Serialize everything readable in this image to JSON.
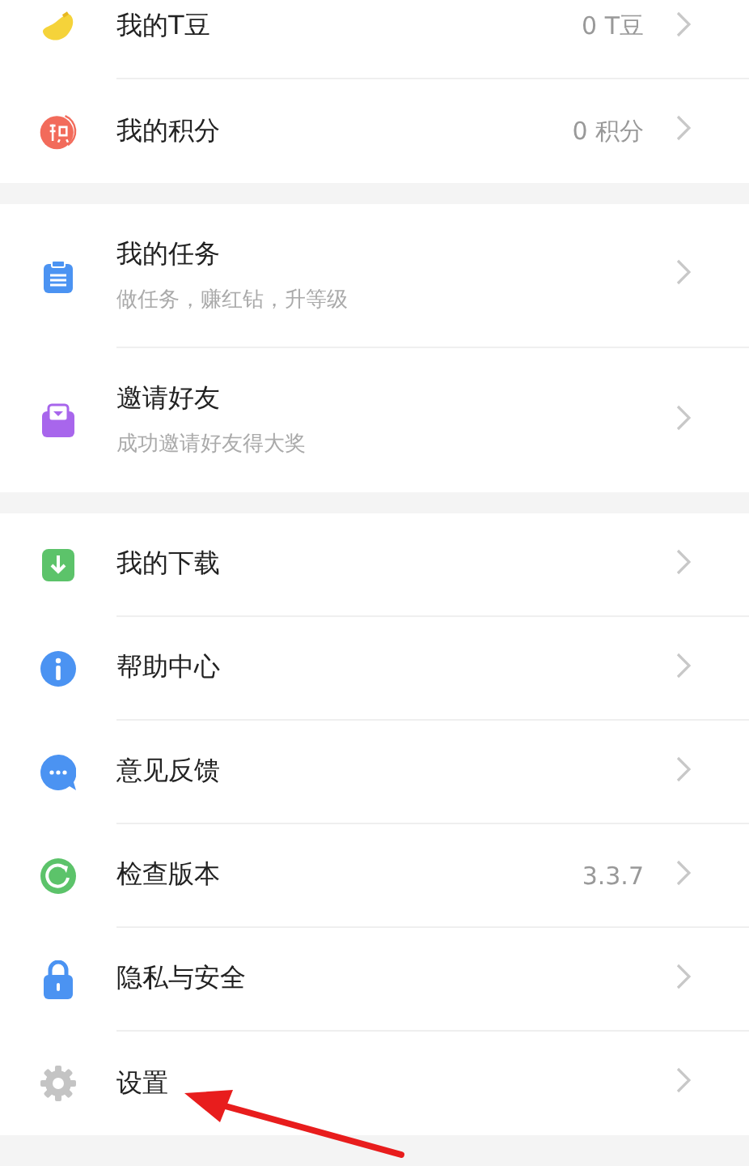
{
  "sections": [
    {
      "items": [
        {
          "title": "我的T豆",
          "value": "0 T豆"
        },
        {
          "title": "我的积分",
          "value": "0 积分"
        }
      ]
    },
    {
      "items": [
        {
          "title": "我的任务",
          "subtitle": "做任务，赚红钻，升等级"
        },
        {
          "title": "邀请好友",
          "subtitle": "成功邀请好友得大奖"
        }
      ]
    },
    {
      "items": [
        {
          "title": "我的下载"
        },
        {
          "title": "帮助中心"
        },
        {
          "title": "意见反馈"
        },
        {
          "title": "检查版本",
          "value": "3.3.7"
        },
        {
          "title": "隐私与安全"
        },
        {
          "title": "设置"
        }
      ]
    }
  ],
  "annotation": {
    "kind": "arrow"
  }
}
